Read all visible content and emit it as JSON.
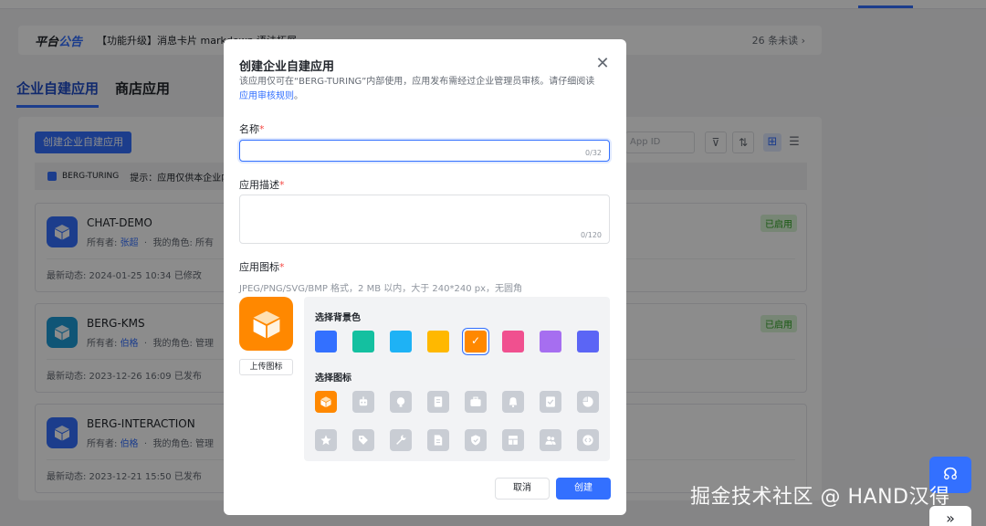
{
  "background": {
    "notice": {
      "logo_a": "平台",
      "logo_b": "公告",
      "text": "【功能升级】消息卡片 markdown 语法拓展",
      "unread": "26 条未读 ›"
    },
    "tabs": [
      {
        "label": "企业自建应用"
      },
      {
        "label": "商店应用"
      }
    ],
    "create_button": "创建企业自建应用",
    "search_placeholder": "App ID",
    "tip": {
      "org": "BERG-TURING",
      "text": "提示：应用仅供本企业内"
    },
    "apps": [
      {
        "name": "CHAT-DEMO",
        "owner_label": "所有者:",
        "owner": "张超",
        "role_label": "我的角色:",
        "role": "所有",
        "activity": "最新动态: 2024-01-25 10:34 已修改",
        "status": "已启用",
        "color": "#3370ff"
      },
      {
        "name": "BERG-KMS",
        "owner_label": "所有者:",
        "owner": "伯格",
        "role_label": "我的角色:",
        "role": "管理",
        "activity": "最新动态: 2023-12-26 16:09 已发布",
        "status": "已启用",
        "color": "#1d9bd8"
      },
      {
        "name": "BERG-INTERACTION",
        "owner_label": "所有者:",
        "owner": "伯格",
        "role_label": "我的角色:",
        "role": "管理",
        "activity": "最新动态: 2023-12-21 15:50 已发布",
        "status": "",
        "color": "#3370ff"
      }
    ],
    "watermark": "掘金技术社区 @ HAND汉得"
  },
  "modal": {
    "title": "创建企业自建应用",
    "desc_prefix": "该应用仅可在“BERG-TURING”内部使用，应用发布需经过企业管理员审核。请仔细阅读 ",
    "desc_link": "应用审核规则",
    "desc_suffix": "。",
    "name_label": "名称",
    "name_value": "",
    "name_counter": "0/32",
    "desc_label": "应用描述",
    "desc_value": "",
    "desc_counter": "0/120",
    "icon_label": "应用图标",
    "icon_hint": "JPEG/PNG/SVG/BMP 格式，2 MB 以内，大于 240*240 px，无圆角",
    "upload_label": "上传图标",
    "bg_color_label": "选择背景色",
    "icon_pick_label": "选择图标",
    "colors": [
      "#3370ff",
      "#14c0a0",
      "#1eb2f5",
      "#ffb800",
      "#ff8800",
      "#f0508f",
      "#a66ef0",
      "#5b65f5"
    ],
    "selected_color": 4,
    "icons": [
      "box-icon",
      "robot-icon",
      "bulb-icon",
      "document-icon",
      "briefcase-icon",
      "bell-icon",
      "checklist-icon",
      "pie-chart-icon",
      "star-icon",
      "tag-icon",
      "wrench-icon",
      "file-icon",
      "shield-icon",
      "layout-icon",
      "users-icon",
      "code-icon"
    ],
    "selected_icon": 0,
    "cancel_label": "取消",
    "create_label": "创建",
    "required_mark": "*"
  }
}
